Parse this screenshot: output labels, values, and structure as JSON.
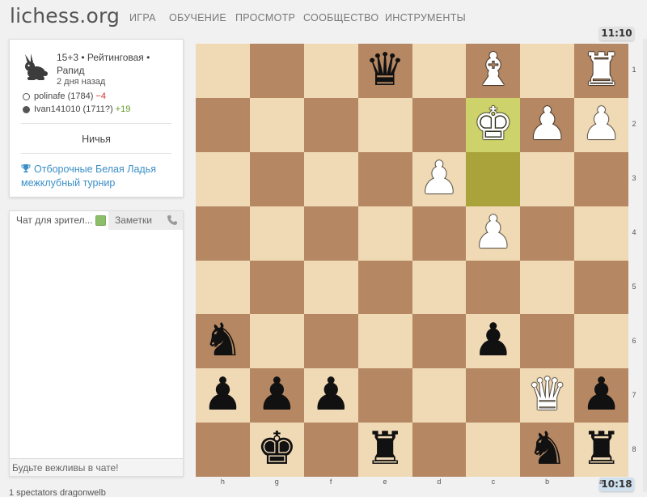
{
  "header": {
    "logo": "lichess.org",
    "nav": [
      "ИГРА",
      "ОБУЧЕНИЕ",
      "ПРОСМОТР",
      "СООБЩЕСТВО",
      "ИНСТРУМЕНТЫ"
    ]
  },
  "clocks": {
    "top": "11:10",
    "bottom": "10:18"
  },
  "game": {
    "line1": "15+3 • Рейтинговая •",
    "line2": "Рапид",
    "date": "2 дня назад",
    "white_player": "polinafe (1784)",
    "white_diff": "−4",
    "black_player": "Ivan141010 (1711?)",
    "black_diff": "+19",
    "result": "Ничья",
    "tournament_line1": "Отборочные Белая Ладья",
    "tournament_line2": "межклубный турнир",
    "speed_icon": "rabbit-icon",
    "tournament_icon": "trophy-icon"
  },
  "chat": {
    "tab_chat": "Чат для зрител...",
    "tab_notes": "Заметки",
    "placeholder": "Будьте вежливы в чате!"
  },
  "footer": {
    "spectators": "1 spectators dragonwelb"
  },
  "board": {
    "orientation": "black",
    "files": [
      "h",
      "g",
      "f",
      "e",
      "d",
      "c",
      "b",
      "a"
    ],
    "ranks": [
      "1",
      "2",
      "3",
      "4",
      "5",
      "6",
      "7",
      "8"
    ],
    "last_move": [
      "c3",
      "c2"
    ],
    "pieces": [
      {
        "sq": "e1",
        "color": "b",
        "type": "q"
      },
      {
        "sq": "c1",
        "color": "w",
        "type": "b"
      },
      {
        "sq": "a1",
        "color": "w",
        "type": "r"
      },
      {
        "sq": "c2",
        "color": "w",
        "type": "k"
      },
      {
        "sq": "b2",
        "color": "w",
        "type": "p"
      },
      {
        "sq": "a2",
        "color": "w",
        "type": "p"
      },
      {
        "sq": "d3",
        "color": "w",
        "type": "p"
      },
      {
        "sq": "c4",
        "color": "w",
        "type": "p"
      },
      {
        "sq": "h6",
        "color": "b",
        "type": "n"
      },
      {
        "sq": "c6",
        "color": "b",
        "type": "p"
      },
      {
        "sq": "h7",
        "color": "b",
        "type": "p"
      },
      {
        "sq": "g7",
        "color": "b",
        "type": "p"
      },
      {
        "sq": "f7",
        "color": "b",
        "type": "p"
      },
      {
        "sq": "b7",
        "color": "w",
        "type": "q"
      },
      {
        "sq": "a7",
        "color": "b",
        "type": "p"
      },
      {
        "sq": "g8",
        "color": "b",
        "type": "k"
      },
      {
        "sq": "e8",
        "color": "b",
        "type": "r"
      },
      {
        "sq": "b8",
        "color": "b",
        "type": "n"
      },
      {
        "sq": "a8",
        "color": "b",
        "type": "r"
      }
    ]
  }
}
